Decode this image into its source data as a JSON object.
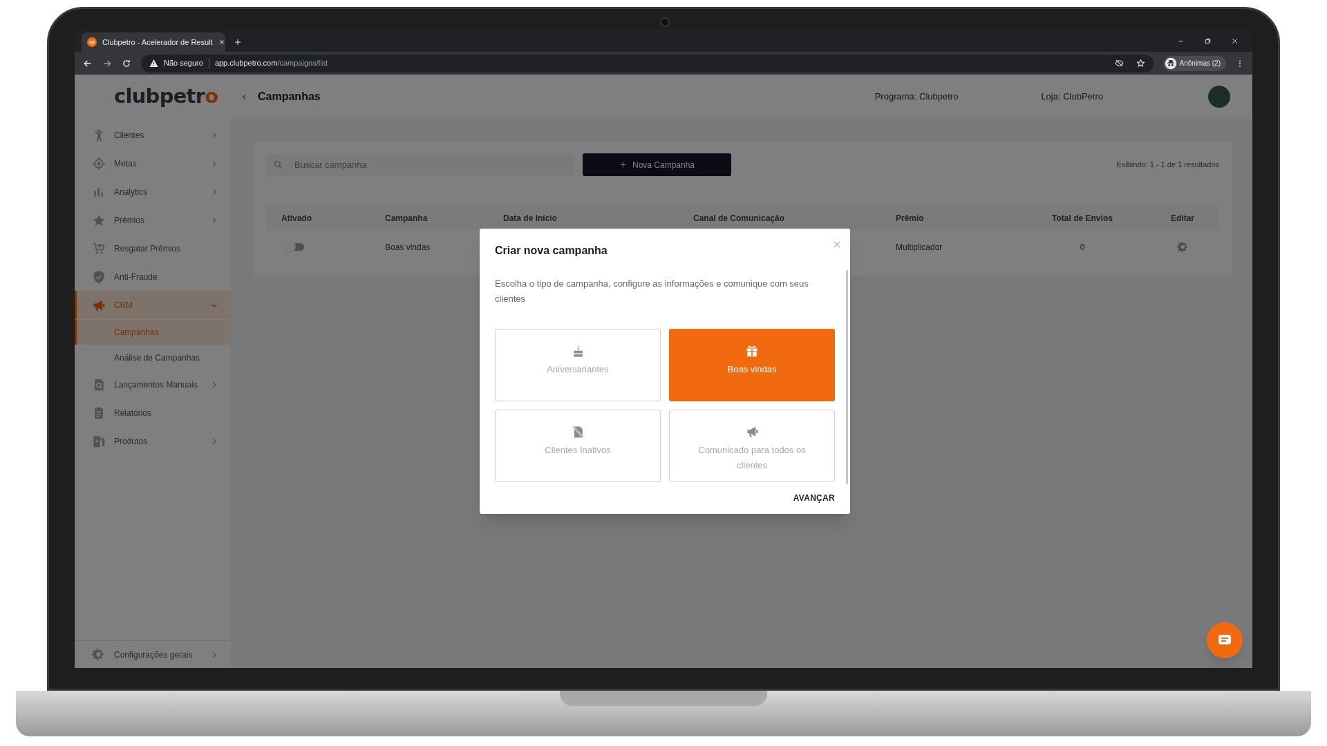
{
  "browser": {
    "tab_title": "Clubpetro - Acelerador de Result",
    "tab_favicon": "cp",
    "security": "Não seguro",
    "url_host": "app.clubpetro.com",
    "url_path": "/campaigns/list",
    "profile": "Anônimas (2)"
  },
  "sidebar": {
    "logo": {
      "text": "clubpetr",
      "accent": "o"
    },
    "items": [
      {
        "label": "Clientes",
        "expanded": false,
        "selected": false
      },
      {
        "label": "Metas",
        "expanded": false,
        "selected": false
      },
      {
        "label": "Analytics",
        "expanded": false,
        "selected": false
      },
      {
        "label": "Prêmios",
        "expanded": false,
        "selected": false
      },
      {
        "label": "Resgatar Prêmios",
        "selected": false
      },
      {
        "label": "Anti-Fraude",
        "selected": false
      },
      {
        "label": "CRM",
        "expanded": true,
        "selected": true,
        "children": [
          {
            "label": "Campanhas",
            "selected": true
          },
          {
            "label": "Análise de Campanhas",
            "selected": false
          }
        ]
      },
      {
        "label": "Lançamentos Manuais",
        "expanded": false,
        "selected": false
      },
      {
        "label": "Relatórios",
        "selected": false
      },
      {
        "label": "Produtos",
        "expanded": false,
        "selected": false
      }
    ],
    "footer_item": {
      "label": "Configurações gerais",
      "expanded": false
    }
  },
  "header": {
    "title": "Campanhas",
    "program_label": "Programa:",
    "program": "Clubpetro",
    "store_label": "Loja:",
    "store": "ClubPetro"
  },
  "toolbar": {
    "search": {
      "placeholder": "Buscar campanha"
    },
    "new_button": "Nova Campanha",
    "results": "Exibindo: 1 - 1 de 1 resultados"
  },
  "table": {
    "columns": [
      "Ativado",
      "Campanha",
      "Data de Início",
      "Canal de Comunicação",
      "Prêmio",
      "Total de Envios",
      "Editar"
    ],
    "rows": [
      {
        "enabled": false,
        "campaign": "Boas vindas",
        "prize": "Multiplicador",
        "total": "0"
      }
    ]
  },
  "modal": {
    "title": "Criar nova campanha",
    "description": "Escolha o tipo de campanha, configure as informações e comunique com seus clientes",
    "options": [
      {
        "label": "Aniversariantes",
        "selected": false
      },
      {
        "label": "Boas vindas",
        "selected": true
      },
      {
        "label": "Clientes Inativos",
        "selected": false
      },
      {
        "label": "Comunicado para todos os clientes",
        "selected": false
      }
    ],
    "next_button": "AVANÇAR"
  },
  "chat_button": true
}
